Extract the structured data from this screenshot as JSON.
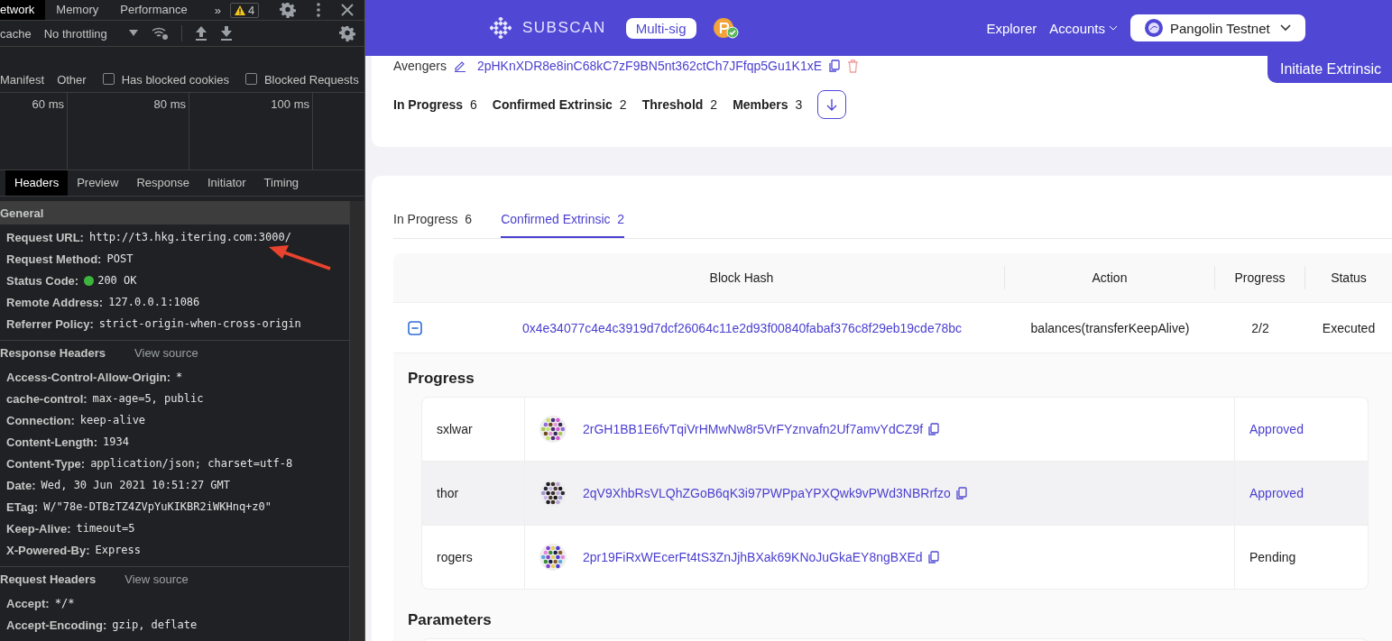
{
  "devtools": {
    "panel_tabs": [
      {
        "label": "etwork",
        "selected": true
      },
      {
        "label": "Memory",
        "selected": false
      },
      {
        "label": "Performance",
        "selected": false
      }
    ],
    "more_tabs": "»",
    "warnings": "4",
    "toolbar": {
      "cache_label": "cache",
      "throttling": "No throttling"
    },
    "filters": [
      {
        "kind": "type",
        "label": "Manifest"
      },
      {
        "kind": "type",
        "label": "Other"
      },
      {
        "kind": "checkbox",
        "label": "Has blocked cookies",
        "checked": false
      },
      {
        "kind": "checkbox",
        "label": "Blocked Requests",
        "checked": false
      }
    ],
    "timeline_ticks": [
      "60 ms",
      "80 ms",
      "100 ms"
    ],
    "detail_tabs": [
      {
        "label": "Headers",
        "selected": true
      },
      {
        "label": "Preview",
        "selected": false
      },
      {
        "label": "Response",
        "selected": false
      },
      {
        "label": "Initiator",
        "selected": false
      },
      {
        "label": "Timing",
        "selected": false
      }
    ],
    "sections": [
      {
        "title": "General",
        "rows": [
          {
            "name": "Request URL:",
            "value": "http://t3.hkg.itering.com:3000/"
          },
          {
            "name": "Request Method:",
            "value": "POST"
          },
          {
            "name": "Status Code:",
            "value": "200 OK",
            "color": "#3db53d"
          },
          {
            "name": "Remote Address:",
            "value": "127.0.0.1:1086"
          },
          {
            "name": "Referrer Policy:",
            "value": "strict-origin-when-cross-origin"
          }
        ]
      },
      {
        "title": "Response Headers",
        "view_source": "View source",
        "rows": [
          {
            "name": "Access-Control-Allow-Origin:",
            "value": "*"
          },
          {
            "name": "cache-control:",
            "value": "max-age=5, public"
          },
          {
            "name": "Connection:",
            "value": "keep-alive"
          },
          {
            "name": "Content-Length:",
            "value": "1934"
          },
          {
            "name": "Content-Type:",
            "value": "application/json; charset=utf-8"
          },
          {
            "name": "Date:",
            "value": "Wed, 30 Jun 2021 10:51:27 GMT"
          },
          {
            "name": "ETag:",
            "value": "W/\"78e-DTBzTZ4ZVpYuKIKBR2iWKHnq+z0\""
          },
          {
            "name": "Keep-Alive:",
            "value": "timeout=5"
          },
          {
            "name": "X-Powered-By:",
            "value": "Express"
          }
        ]
      },
      {
        "title": "Request Headers",
        "view_source": "View source",
        "rows": [
          {
            "name": "Accept:",
            "value": "*/*"
          },
          {
            "name": "Accept-Encoding:",
            "value": "gzip, deflate"
          }
        ]
      }
    ]
  },
  "header": {
    "logo": "SUBSCAN",
    "badge": "Multi-sig",
    "nav": [
      {
        "label": "Explorer",
        "dropdown": false
      },
      {
        "label": "Accounts",
        "dropdown": true
      }
    ],
    "network": "Pangolin Testnet"
  },
  "account": {
    "name": "Avengers",
    "address": "2pHKnXDR8e8inC68kC7zF9BN5nt362ctCh7JFfqp5Gu1K1xE",
    "stats": [
      {
        "label": "In Progress",
        "value": "6"
      },
      {
        "label": "Confirmed Extrinsic",
        "value": "2"
      },
      {
        "label": "Threshold",
        "value": "2"
      },
      {
        "label": "Members",
        "value": "3"
      }
    ],
    "action": "Initiate Extrinsic"
  },
  "list": {
    "tabs": [
      {
        "label": "In Progress",
        "count": "6",
        "selected": false
      },
      {
        "label": "Confirmed Extrinsic",
        "count": "2",
        "selected": true
      }
    ],
    "columns": [
      "Block Hash",
      "Action",
      "Progress",
      "Status"
    ],
    "rows": [
      {
        "expanded": true,
        "block_hash": "0x4e34077c4e4c3919d7dcf26064c11e2d93f00840fabaf376c8f29eb19cde78bc",
        "action": "balances(transferKeepAlive)",
        "progress": "2/2",
        "status": "Executed",
        "detail": {
          "progress_title": "Progress",
          "approvals": [
            {
              "name": "sxlwar",
              "address": "2rGH1BB1E6fvTqiVrHMwNw8r5VrFYznvafn2Uf7amvYdCZ9f",
              "status": "Approved",
              "approved": true,
              "highlighted": false
            },
            {
              "name": "thor",
              "address": "2qV9XhbRsVLQhZGoB6qK3i97PWPpaYPXQwk9vPWd3NBRrfzo",
              "status": "Approved",
              "approved": true,
              "highlighted": true
            },
            {
              "name": "rogers",
              "address": "2pr19FiRxWEcerFt4tS3ZnJjhBXak69KNoJuGkaEY8ngBXEd",
              "status": "Pending",
              "approved": false,
              "highlighted": false
            }
          ],
          "parameters_title": "Parameters"
        }
      }
    ]
  }
}
